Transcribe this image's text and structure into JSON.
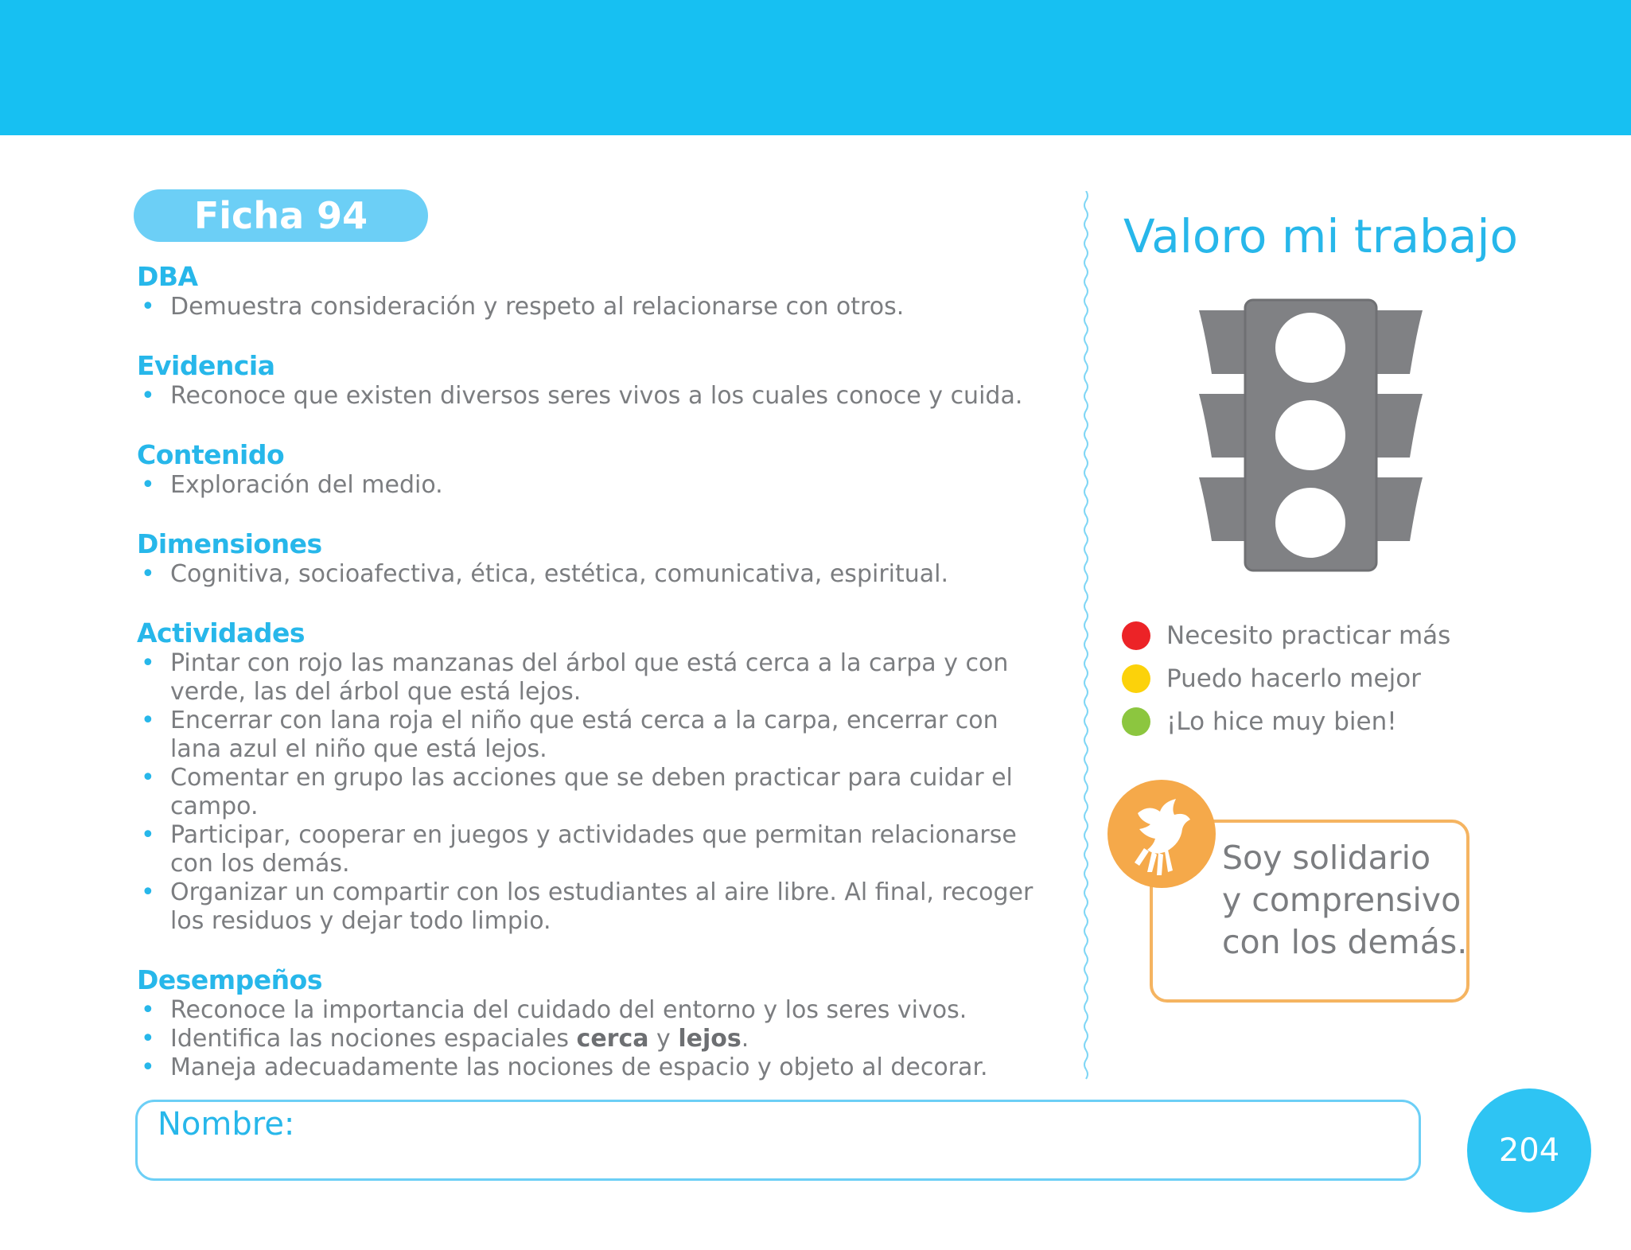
{
  "header": {
    "band_color": "#17c0f2"
  },
  "ficha": {
    "label": "Ficha 94"
  },
  "sections": {
    "dba": {
      "title": "DBA",
      "items": [
        "Demuestra consideración y respeto al relacionarse con otros."
      ]
    },
    "evidencia": {
      "title": "Evidencia",
      "items": [
        "Reconoce que existen diversos seres vivos a los cuales conoce y cuida."
      ]
    },
    "contenido": {
      "title": "Contenido",
      "items": [
        "Exploración del medio."
      ]
    },
    "dimensiones": {
      "title": "Dimensiones",
      "items": [
        "Cognitiva, socioafectiva, ética, estética, comunicativa, espiritual."
      ]
    },
    "actividades": {
      "title": "Actividades",
      "items": [
        "Pintar con rojo las manzanas del árbol que está cerca a la carpa y con verde, las del árbol que está lejos.",
        "Encerrar con lana roja el niño que está cerca a la carpa, encerrar con lana azul el niño que está lejos.",
        "Comentar en grupo las acciones que se deben practicar para cuidar el campo.",
        "Participar, cooperar en juegos y actividades que permitan relacionarse con los demás.",
        "Organizar un compartir con los estudiantes al aire libre. Al final, recoger los residuos y dejar todo limpio."
      ]
    },
    "desempenos": {
      "title": "Desempeños",
      "item1": "Reconoce la importancia del cuidado del entorno y los seres vivos.",
      "item2_pre": "Identifica las nociones espaciales ",
      "item2_bold1": "cerca",
      "item2_mid": " y ",
      "item2_bold2": "lejos",
      "item2_post": ".",
      "item3": "Maneja adecuadamente las nociones de espacio y objeto al decorar."
    }
  },
  "valoro": {
    "title": "Valoro mi trabajo",
    "legend": [
      {
        "label": "Necesito practicar más",
        "color": "#ec2327"
      },
      {
        "label": "Puedo hacerlo mejor",
        "color": "#fcd20a"
      },
      {
        "label": "¡Lo hice muy bien!",
        "color": "#8cc63f"
      }
    ]
  },
  "value_card": {
    "line1": "Soy solidario",
    "line2": "y comprensivo",
    "line3": "con los demás.",
    "icon": "dove-hand-icon"
  },
  "footer": {
    "nombre_label": "Nombre:",
    "page_number": "204"
  }
}
